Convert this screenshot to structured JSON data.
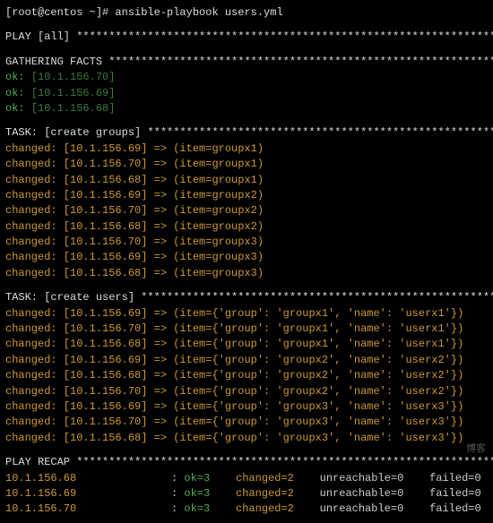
{
  "prompt": "[root@centos ~]# ",
  "command": "ansible-playbook users.yml",
  "play_header": "PLAY [all] ",
  "play_stars": "*******************************************************************",
  "facts_header": "GATHERING FACTS ",
  "facts_stars": "**************************************************************",
  "facts": [
    {
      "status": "ok",
      "host": "10.1.156.70"
    },
    {
      "status": "ok",
      "host": "10.1.156.69"
    },
    {
      "status": "ok",
      "host": "10.1.156.68"
    }
  ],
  "task1_header": "TASK: [create groups] ",
  "task1_stars": "********************************************************",
  "task1": [
    {
      "status": "changed",
      "host": "10.1.156.69",
      "item": "groupx1"
    },
    {
      "status": "changed",
      "host": "10.1.156.70",
      "item": "groupx1"
    },
    {
      "status": "changed",
      "host": "10.1.156.68",
      "item": "groupx1"
    },
    {
      "status": "changed",
      "host": "10.1.156.69",
      "item": "groupx2"
    },
    {
      "status": "changed",
      "host": "10.1.156.70",
      "item": "groupx2"
    },
    {
      "status": "changed",
      "host": "10.1.156.68",
      "item": "groupx2"
    },
    {
      "status": "changed",
      "host": "10.1.156.70",
      "item": "groupx3"
    },
    {
      "status": "changed",
      "host": "10.1.156.69",
      "item": "groupx3"
    },
    {
      "status": "changed",
      "host": "10.1.156.68",
      "item": "groupx3"
    }
  ],
  "task2_header": "TASK: [create users] ",
  "task2_stars": "*********************************************************",
  "task2": [
    {
      "status": "changed",
      "host": "10.1.156.69",
      "group": "groupx1",
      "name": "userx1"
    },
    {
      "status": "changed",
      "host": "10.1.156.70",
      "group": "groupx1",
      "name": "userx1"
    },
    {
      "status": "changed",
      "host": "10.1.156.68",
      "group": "groupx1",
      "name": "userx1"
    },
    {
      "status": "changed",
      "host": "10.1.156.69",
      "group": "groupx2",
      "name": "userx2"
    },
    {
      "status": "changed",
      "host": "10.1.156.68",
      "group": "groupx2",
      "name": "userx2"
    },
    {
      "status": "changed",
      "host": "10.1.156.70",
      "group": "groupx2",
      "name": "userx2"
    },
    {
      "status": "changed",
      "host": "10.1.156.69",
      "group": "groupx3",
      "name": "userx3"
    },
    {
      "status": "changed",
      "host": "10.1.156.70",
      "group": "groupx3",
      "name": "userx3"
    },
    {
      "status": "changed",
      "host": "10.1.156.68",
      "group": "groupx3",
      "name": "userx3"
    }
  ],
  "recap_header": "PLAY RECAP ",
  "recap_stars": "*******************************************************************",
  "recap": [
    {
      "host": "10.1.156.68",
      "ok": 3,
      "changed": 2,
      "unreachable": 0,
      "failed": 0
    },
    {
      "host": "10.1.156.69",
      "ok": 3,
      "changed": 2,
      "unreachable": 0,
      "failed": 0
    },
    {
      "host": "10.1.156.70",
      "ok": 3,
      "changed": 2,
      "unreachable": 0,
      "failed": 0
    }
  ],
  "watermark": "博客"
}
